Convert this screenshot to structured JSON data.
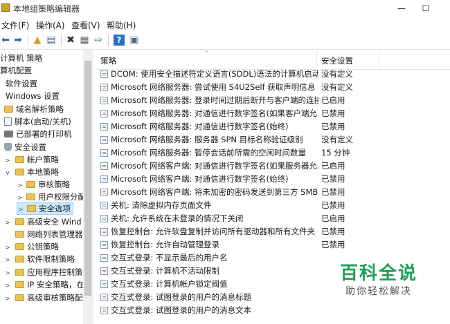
{
  "window": {
    "title": "本地组策略编辑器",
    "minimize": "—",
    "maximize": "☐"
  },
  "menu": [
    "文件(F)",
    "操作(A)",
    "查看(V)",
    "帮助(H)"
  ],
  "toolbar": [
    {
      "icon": "back-arrow-icon",
      "glyph": "⬅"
    },
    {
      "icon": "forward-arrow-icon",
      "glyph": "➡"
    },
    {
      "icon": "up-folder-icon",
      "glyph": "▲"
    },
    {
      "icon": "show-hide-tree-icon",
      "glyph": "▤"
    },
    {
      "icon": "delete-icon",
      "glyph": "✖"
    },
    {
      "icon": "properties-icon",
      "glyph": "▦"
    },
    {
      "icon": "export-list-icon",
      "glyph": "⇨"
    },
    {
      "icon": "help-icon",
      "glyph": "?"
    },
    {
      "icon": "show-pane-icon",
      "glyph": "▣"
    }
  ],
  "tree": [
    {
      "label": "计算机 策略",
      "indent": 0,
      "twisty": "",
      "icon": "none"
    },
    {
      "label": "算机配置",
      "indent": 0,
      "twisty": "",
      "icon": "none"
    },
    {
      "label": "软件设置",
      "indent": 1,
      "twisty": "",
      "icon": "none"
    },
    {
      "label": "Windows 设置",
      "indent": 1,
      "twisty": "",
      "icon": "none"
    },
    {
      "label": "域名解析策略",
      "indent": 1,
      "twisty": "",
      "icon": "folder"
    },
    {
      "label": "脚本(启动/关机)",
      "indent": 1,
      "twisty": "",
      "icon": "doc"
    },
    {
      "label": "已部署的打印机",
      "indent": 1,
      "twisty": "",
      "icon": "printer"
    },
    {
      "label": "安全设置",
      "indent": 1,
      "twisty": "",
      "icon": "shield"
    },
    {
      "label": "帐户策略",
      "indent": 2,
      "twisty": ">",
      "icon": "folder"
    },
    {
      "label": "本地策略",
      "indent": 2,
      "twisty": "v",
      "icon": "folder"
    },
    {
      "label": "审核策略",
      "indent": 3,
      "twisty": ">",
      "icon": "folder"
    },
    {
      "label": "用户权限分配",
      "indent": 3,
      "twisty": ">",
      "icon": "folder"
    },
    {
      "label": "安全选项",
      "indent": 3,
      "twisty": ">",
      "icon": "folder",
      "selected": true
    },
    {
      "label": "高级安全 Wind",
      "indent": 2,
      "twisty": ">",
      "icon": "folder"
    },
    {
      "label": "网络列表管理器",
      "indent": 2,
      "twisty": "",
      "icon": "folder"
    },
    {
      "label": "公钥策略",
      "indent": 2,
      "twisty": ">",
      "icon": "folder"
    },
    {
      "label": "软件限制策略",
      "indent": 2,
      "twisty": ">",
      "icon": "folder"
    },
    {
      "label": "应用程序控制策",
      "indent": 2,
      "twisty": ">",
      "icon": "folder"
    },
    {
      "label": "IP 安全策略，在",
      "indent": 2,
      "twisty": ">",
      "icon": "folder"
    },
    {
      "label": "高级审核策略配",
      "indent": 2,
      "twisty": ">",
      "icon": "folder"
    }
  ],
  "list": {
    "col_policy": "策略",
    "col_setting": "安全设置",
    "rows": [
      {
        "name": "DCOM: 使用安全描述符定义语言(SDDL)语法的计算机启动...",
        "setting": "没有定义"
      },
      {
        "name": "Microsoft 网络服务器: 尝试使用 S4U2Self 获取声明信息",
        "setting": "没有定义"
      },
      {
        "name": "Microsoft 网络服务器: 登录时间过期后断开与客户端的连接",
        "setting": "已启用"
      },
      {
        "name": "Microsoft 网络服务器: 对通信进行数字签名(如果客户端允...",
        "setting": "已禁用"
      },
      {
        "name": "Microsoft 网络服务器: 对通信进行数字签名(始终)",
        "setting": "已禁用"
      },
      {
        "name": "Microsoft 网络服务器: 服务器 SPN 目标名称验证级别",
        "setting": "没有定义"
      },
      {
        "name": "Microsoft 网络服务器: 暂停会话前所需的空闲时间数量",
        "setting": "15 分钟"
      },
      {
        "name": "Microsoft 网络客户端: 对通信进行数字签名(如果服务器允...",
        "setting": "已启用"
      },
      {
        "name": "Microsoft 网络客户端: 对通信进行数字签名(始终)",
        "setting": "已禁用"
      },
      {
        "name": "Microsoft 网络客户端: 将未加密的密码发送到第三方 SMB...",
        "setting": "已禁用"
      },
      {
        "name": "关机: 清除虚拟内存页面文件",
        "setting": "已禁用"
      },
      {
        "name": "关机: 允许系统在未登录的情况下关闭",
        "setting": "已启用"
      },
      {
        "name": "恢复控制台: 允许软盘复制并访问所有驱动器和所有文件夹",
        "setting": "已禁用"
      },
      {
        "name": "恢复控制台: 允许自动管理登录",
        "setting": "已禁用"
      },
      {
        "name": "交互式登录: 不显示最后的用户名",
        "setting": ""
      },
      {
        "name": "交互式登录: 计算机不活动限制",
        "setting": ""
      },
      {
        "name": "交互式登录: 计算机帐户锁定阈值",
        "setting": ""
      },
      {
        "name": "交互式登录: 试图登录的用户的消息标题",
        "setting": ""
      },
      {
        "name": "交互式登录: 试图登录的用户的消息文本",
        "setting": ""
      }
    ]
  },
  "watermark": {
    "main": "百科全说",
    "sub": "助你轻松解决"
  }
}
